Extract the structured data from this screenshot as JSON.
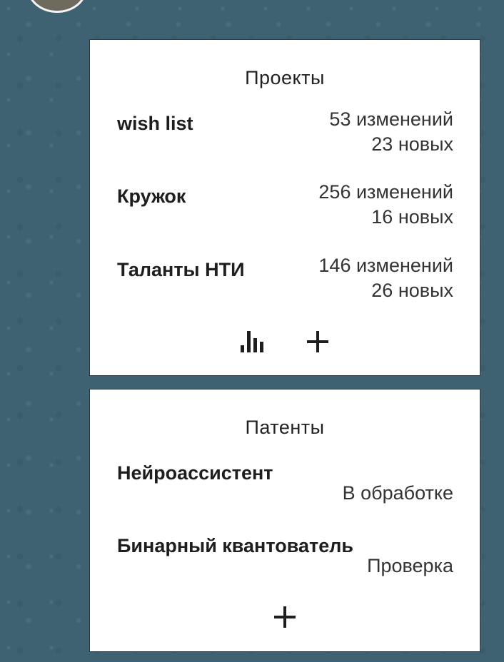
{
  "projects": {
    "title": "Проекты",
    "items": [
      {
        "name": "wish list",
        "changes": "53 изменений",
        "new": "23 новых"
      },
      {
        "name": "Кружок",
        "changes": "256 изменений",
        "new": "16 новых"
      },
      {
        "name": "Таланты НТИ",
        "changes": "146 изменений",
        "new": "26 новых"
      }
    ],
    "stats_icon": "bar-chart-icon",
    "add_icon": "plus-icon",
    "add_glyph": "+"
  },
  "patents": {
    "title": "Патенты",
    "items": [
      {
        "name": "Нейроассистент",
        "status": "В обработке"
      },
      {
        "name": "Бинарный квантователь",
        "status": "Проверка"
      }
    ],
    "add_icon": "plus-icon",
    "add_glyph": "+"
  },
  "colors": {
    "background": "#3f6272",
    "card": "#ffffff",
    "text": "#1e1e1e"
  }
}
